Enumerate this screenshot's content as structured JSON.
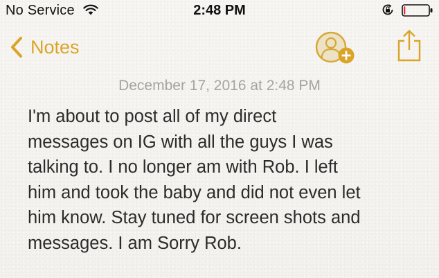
{
  "status_bar": {
    "carrier": "No Service",
    "time": "2:48 PM",
    "wifi_icon": "wifi-icon",
    "rotation_lock_icon": "rotation-lock-icon",
    "battery_icon": "battery-icon",
    "battery_level": 0.06,
    "battery_color": "#e0262c"
  },
  "nav": {
    "back_label": "Notes",
    "back_icon": "chevron-left-icon",
    "add_person_icon": "add-person-icon",
    "share_icon": "share-icon",
    "accent_color": "#dba427"
  },
  "note": {
    "date": "December 17, 2016 at 2:48 PM",
    "lines": [
      "I'm about to post all of my direct",
      "messages on IG with all the guys I was",
      "talking to. I no longer am with Rob. I left",
      "him and took the baby and did not even let",
      "him know. Stay tuned for screen shots and",
      "messages. I am Sorry Rob."
    ]
  }
}
